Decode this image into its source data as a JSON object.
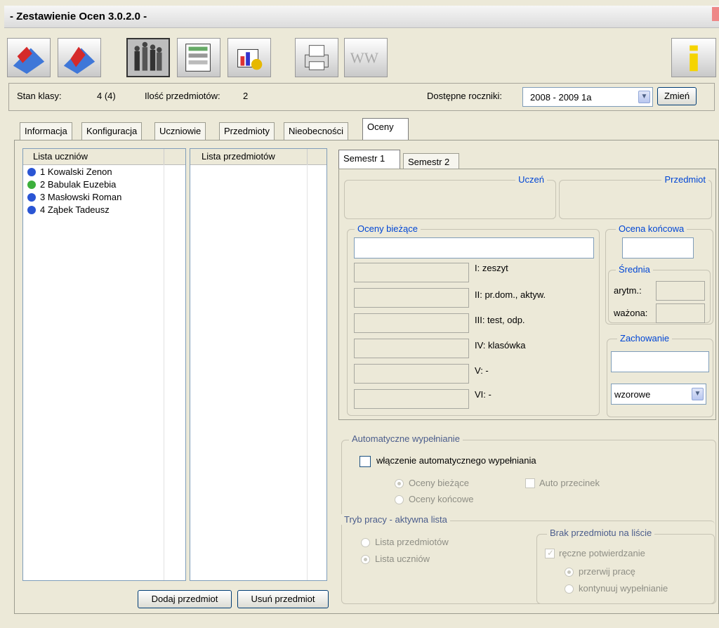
{
  "window": {
    "title": "- Zestawienie Ocen 3.0.2.0 -"
  },
  "toolbar": {
    "buttons": [
      "open-icon",
      "save-icon",
      "students-icon",
      "grades-icon",
      "chart-icon",
      "print-icon",
      "www-icon",
      "info-icon"
    ]
  },
  "status": {
    "class_state_label": "Stan klasy:",
    "class_state_value": "4 (4)",
    "subjects_count_label": "Ilość przedmiotów:",
    "subjects_count_value": "2",
    "years_label": "Dostępne roczniki:",
    "years_value": "2008 - 2009  1a",
    "change_button": "Zmień"
  },
  "tabs": [
    "Informacja",
    "Konfiguracja",
    "Uczniowie",
    "Przedmioty",
    "Nieobecności",
    "Oceny"
  ],
  "students": {
    "header": "Lista uczniów",
    "items": [
      "1  Kowalski  Zenon",
      "2  Babulak  Euzebia",
      "3  Masłowski  Roman",
      "4  Ząbek  Tadeusz"
    ]
  },
  "subjects": {
    "header": "Lista przedmiotów"
  },
  "buttons": {
    "add_subject": "Dodaj przedmiot",
    "remove_subject": "Usuń przedmiot"
  },
  "semester_tabs": [
    "Semestr 1",
    "Semestr 2"
  ],
  "grades": {
    "student_group": "Uczeń",
    "subject_group": "Przedmiot",
    "current_group": "Oceny bieżące",
    "rows": [
      "I: zeszyt",
      "II: pr.dom., aktyw.",
      "III: test, odp.",
      "IV: klasówka",
      "V: -",
      "VI: -"
    ],
    "final_group": "Ocena końcowa",
    "average_group": "Średnia",
    "arithmetic_label": "arytm.:",
    "weighted_label": "ważona:",
    "behaviour_group": "Zachowanie",
    "behaviour_value": "wzorowe"
  },
  "auto_fill": {
    "group": "Automatyczne wypełnianie",
    "enable_label": "włączenie automatycznego wypełniania",
    "current_grades": "Oceny bieżące",
    "final_grades": "Oceny końcowe",
    "auto_comma": "Auto przecinek"
  },
  "work_mode": {
    "group": "Tryb pracy - aktywna lista",
    "subjects_list": "Lista przedmiotów",
    "students_list": "Lista uczniów"
  },
  "missing_subject": {
    "group": "Brak przedmiotu na liście",
    "manual_confirm": "ręczne potwierdzanie",
    "interrupt": "przerwij pracę",
    "continue": "kontynuuj wypełnianie"
  }
}
